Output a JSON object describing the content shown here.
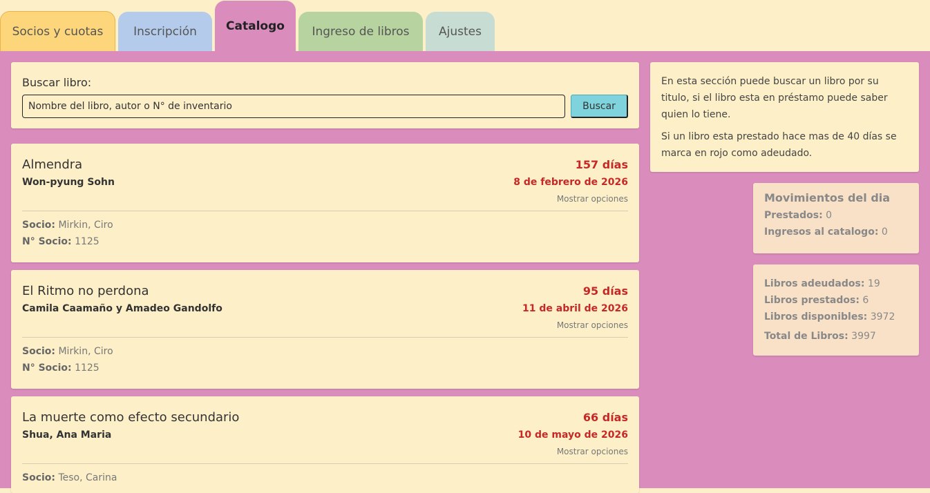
{
  "tabs": [
    {
      "label": "Socios y cuotas"
    },
    {
      "label": "Inscripción"
    },
    {
      "label": "Catalogo",
      "active": true
    },
    {
      "label": "Ingreso de libros"
    },
    {
      "label": "Ajustes"
    }
  ],
  "search": {
    "label": "Buscar libro:",
    "placeholder": "Nombre del libro, autor o N° de inventario",
    "button": "Buscar"
  },
  "books": [
    {
      "title": "Almendra",
      "author": "Won-pyung Sohn",
      "days": "157 días",
      "date": "8 de febrero de 2026",
      "options": "Mostrar opciones",
      "socio_label": "Socio:",
      "socio": "Mirkin, Ciro",
      "nsocio_label": "N° Socio:",
      "nsocio": "1125"
    },
    {
      "title": "El Ritmo no perdona",
      "author": "Camila Caamaño y Amadeo Gandolfo",
      "days": "95 días",
      "date": "11 de abril de 2026",
      "options": "Mostrar opciones",
      "socio_label": "Socio:",
      "socio": "Mirkin, Ciro",
      "nsocio_label": "N° Socio:",
      "nsocio": "1125"
    },
    {
      "title": "La muerte como efecto secundario",
      "author": "Shua, Ana Maria",
      "days": "66 días",
      "date": "10 de mayo de 2026",
      "options": "Mostrar opciones",
      "socio_label": "Socio:",
      "socio": "Teso, Carina"
    }
  ],
  "info": {
    "p1": "En esta sección puede buscar un libro por su titulo, si el libro esta en préstamo puede saber quien lo tiene.",
    "p2": "Si un libro esta prestado hace mas de 40 días se marca en rojo como adeudado."
  },
  "movimientos": {
    "title": "Movimientos del dia",
    "prestados_label": "Prestados:",
    "prestados": "0",
    "ingresos_label": "Ingresos al catalogo:",
    "ingresos": "0"
  },
  "totals": {
    "adeudados_label": "Libros adeudados:",
    "adeudados": "19",
    "prestados_label": "Libros prestados:",
    "prestados": "6",
    "disponibles_label": "Libros disponibles:",
    "disponibles": "3972",
    "total_label": "Total de Libros:",
    "total": "3997"
  },
  "colors": {
    "content_bg": "#da8cbd",
    "card_bg": "#fdf0c8",
    "overdue": "#c62828",
    "search_button": "#7fd3dc"
  }
}
